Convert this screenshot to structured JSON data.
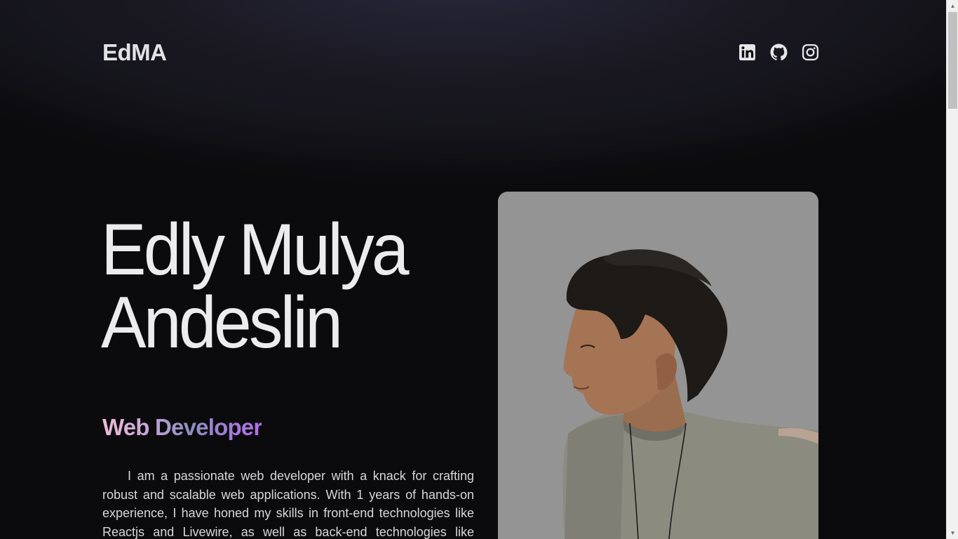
{
  "header": {
    "logo": "EdMA",
    "socials": [
      {
        "name": "linkedin",
        "icon": "linkedin-icon"
      },
      {
        "name": "github",
        "icon": "github-icon"
      },
      {
        "name": "instagram",
        "icon": "instagram-icon"
      }
    ]
  },
  "hero": {
    "name_line1": "Edly Mulya",
    "name_line2": "Andeslin",
    "role": "Web Developer",
    "bio": "I am a passionate web developer with a knack for crafting robust and scalable web applications. With 1 years of hands-on experience, I have honed my skills in front-end technologies like Reactjs and Livewire, as well as back-end technologies like Laravel, Node.js, MySQL,"
  },
  "colors": {
    "background": "#0b0b0e",
    "text": "#ececee",
    "role_gradient_start": "#f0bcd6",
    "role_gradient_end": "#b26fe8",
    "photo_background": "#949494"
  },
  "scrollbar": {
    "up_glyph": "▲",
    "down_glyph": "▼"
  }
}
